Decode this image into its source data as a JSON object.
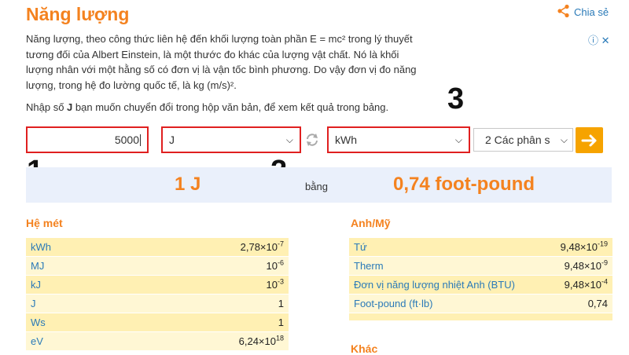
{
  "page": {
    "title": "Năng lượng",
    "share_label": "Chia sẻ",
    "ad_icon": "ⓘ ✕",
    "description": "Năng lượng, theo công thức liên hệ đến khối lượng toàn phần E = mc² trong lý thuyết tương đối của Albert Einstein, là một thước đo khác của lượng vật chất. Nó là khối lượng nhân với một hằng số có đơn vị là vận tốc bình phương. Do vậy đơn vị đo năng lượng, trong hệ đo lường quốc tế, là kg (m/s)².",
    "instruction_pre": "Nhập số ",
    "instruction_bold": "J",
    "instruction_post": " bạn muốn chuyển đổi trong hộp văn bản, để xem kết quả trong bảng."
  },
  "converter": {
    "input_value": "5000",
    "from_unit": "J",
    "to_unit": "kWh",
    "precision": "2 Các phân s",
    "swap_icon": "refresh-icon",
    "go_icon": "arrow-right-icon"
  },
  "annotations": [
    "1",
    "2",
    "3"
  ],
  "result": {
    "left": "1 J",
    "middle": "bằng",
    "right": "0,74 foot-pound"
  },
  "metric": {
    "heading": "Hệ mét",
    "rows": [
      {
        "label": "kWh",
        "mant": "2,78×10",
        "exp": "-7"
      },
      {
        "label": "MJ",
        "mant": "10",
        "exp": "-6"
      },
      {
        "label": "kJ",
        "mant": "10",
        "exp": "-3"
      },
      {
        "label": "J",
        "mant": "1",
        "exp": ""
      },
      {
        "label": "Ws",
        "mant": "1",
        "exp": ""
      },
      {
        "label": "eV",
        "mant": "6,24×10",
        "exp": "18"
      }
    ]
  },
  "imperial": {
    "heading": "Anh/Mỹ",
    "rows": [
      {
        "label": "Tứ",
        "mant": "9,48×10",
        "exp": "-19"
      },
      {
        "label": "Therm",
        "mant": "9,48×10",
        "exp": "-9"
      },
      {
        "label": "Đơn vị năng lượng nhiệt Anh (BTU)",
        "mant": "9,48×10",
        "exp": "-4"
      },
      {
        "label": "Foot-pound (ft·lb)",
        "mant": "0,74",
        "exp": ""
      }
    ]
  },
  "other": {
    "heading": "Khác"
  },
  "colors": {
    "accent": "#f4821f",
    "link": "#2a7ab8",
    "annotation_red": "#e02020",
    "go_button": "#f6a300"
  }
}
